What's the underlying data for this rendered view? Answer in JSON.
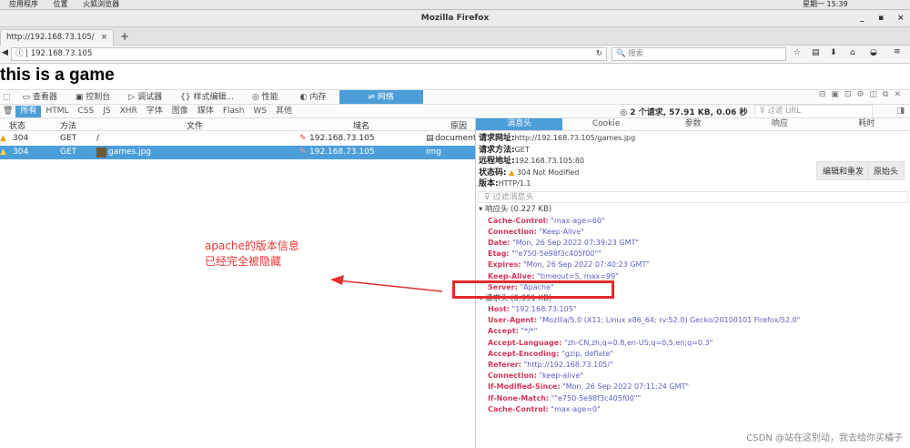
{
  "system": {
    "menus": [
      "应用程序",
      "位置",
      "火狐浏览器"
    ],
    "clock": "星期一 15:39"
  },
  "window": {
    "title": "Mozilla Firefox"
  },
  "tab": {
    "title": "http://192.168.73.105/",
    "close": "×",
    "new": "+"
  },
  "nav": {
    "url": "192.168.73.105",
    "search_placeholder": "搜索"
  },
  "page": {
    "heading": "this is a game"
  },
  "devtools": {
    "tools": [
      "查看器",
      "控制台",
      "调试器",
      "样式编辑...",
      "性能",
      "内存",
      "网络"
    ],
    "filters": [
      "所有",
      "HTML",
      "CSS",
      "JS",
      "XHR",
      "字体",
      "图像",
      "媒体",
      "Flash",
      "WS",
      "其他"
    ],
    "summary": "2 个请求, 57.91 KB, 0.06 秒",
    "filter_url_placeholder": "过滤 URL",
    "columns": [
      "状态",
      "方法",
      "文件",
      "域名",
      "原因"
    ],
    "rows": [
      {
        "status": "304",
        "method": "GET",
        "file": "/",
        "domain": "192.168.73.105",
        "cause": "document"
      },
      {
        "status": "304",
        "method": "GET",
        "file": "games.jpg",
        "domain": "192.168.73.105",
        "cause": "img"
      }
    ],
    "detail_tabs": [
      "消息头",
      "Cookie",
      "参数",
      "响应",
      "耗时"
    ],
    "summary_fields": [
      {
        "label": "请求网址:",
        "value": "http://192.168.73.105/games.jpg"
      },
      {
        "label": "请求方法:",
        "value": "GET"
      },
      {
        "label": "远程地址:",
        "value": "192.168.73.105:80"
      },
      {
        "label": "状态码:",
        "value": "304 Not Modified"
      },
      {
        "label": "版本:",
        "value": "HTTP/1.1"
      }
    ],
    "edit_resend": "编辑和重发",
    "raw_headers": "原始头",
    "filter_headers_placeholder": "过滤消息头",
    "response_section": "响应头 (0.227 KB)",
    "response_headers": [
      {
        "k": "Cache-Control:",
        "v": "\"max-age=60\""
      },
      {
        "k": "Connection:",
        "v": "\"Keep-Alive\""
      },
      {
        "k": "Date:",
        "v": "\"Mon, 26 Sep 2022 07:39:23 GMT\""
      },
      {
        "k": "Etag:",
        "v": "\"\"e750-5e98f3c405f00\"\""
      },
      {
        "k": "Expires:",
        "v": "\"Mon, 26 Sep 2022 07:40:23 GMT\""
      },
      {
        "k": "Keep-Alive:",
        "v": "\"timeout=5, max=99\""
      },
      {
        "k": "Server:",
        "v": "\"Apache\""
      }
    ],
    "request_section": "请求头 (0.391 KB)",
    "request_headers": [
      {
        "k": "Host:",
        "v": "\"192.168.73.105\""
      },
      {
        "k": "User-Agent:",
        "v": "\"Mozilla/5.0 (X11; Linux x86_64; rv:52.0) Gecko/20100101 Firefox/52.0\""
      },
      {
        "k": "Accept:",
        "v": "\"*/*\""
      },
      {
        "k": "Accept-Language:",
        "v": "\"zh-CN,zh;q=0.8,en-US;q=0.5,en;q=0.3\""
      },
      {
        "k": "Accept-Encoding:",
        "v": "\"gzip, deflate\""
      },
      {
        "k": "Referer:",
        "v": "\"http://192.168.73.105/\""
      },
      {
        "k": "Connection:",
        "v": "\"keep-alive\""
      },
      {
        "k": "If-Modified-Since:",
        "v": "\"Mon, 26 Sep 2022 07:11:24 GMT\""
      },
      {
        "k": "If-None-Match:",
        "v": "\"\"e750-5e98f3c405f00\"\""
      },
      {
        "k": "Cache-Control:",
        "v": "\"max-age=0\""
      }
    ]
  },
  "annotation": {
    "line1": "apache的版本信息",
    "line2": "已经完全被隐藏",
    "color": "#ee3535"
  },
  "watermark": "CSDN @站在这别动，我去给你买橘子"
}
